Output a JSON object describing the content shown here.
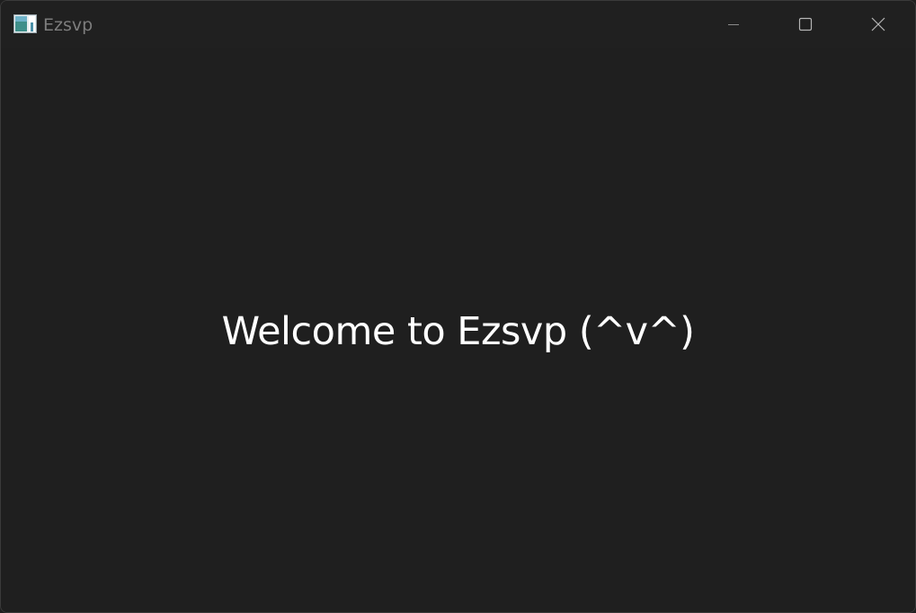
{
  "window": {
    "title": "Ezsvp",
    "icon": "app-window-icon"
  },
  "caption_buttons": {
    "minimize": "minimize-icon",
    "maximize": "maximize-icon",
    "close": "close-icon"
  },
  "main": {
    "welcome_text": "Welcome to Ezsvp (^v^)"
  },
  "colors": {
    "background": "#1f1f1f",
    "titlebar": "#202020",
    "title_text": "#7d7d7d",
    "body_text": "#ffffff"
  }
}
